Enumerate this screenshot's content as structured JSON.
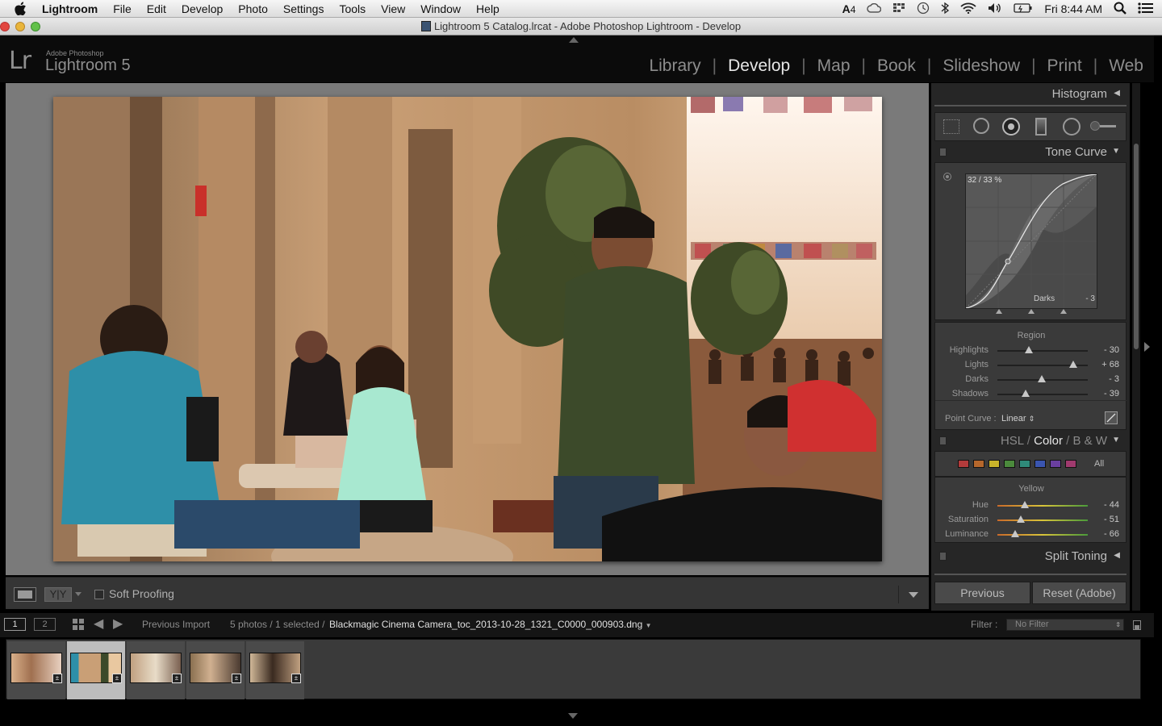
{
  "menubar": {
    "app_name": "Lightroom",
    "items": [
      "File",
      "Edit",
      "Develop",
      "Photo",
      "Settings",
      "Tools",
      "View",
      "Window",
      "Help"
    ],
    "status_badge": "4",
    "clock": "Fri 8:44 AM"
  },
  "window": {
    "title": "Lightroom 5 Catalog.lrcat - Adobe Photoshop Lightroom - Develop"
  },
  "brand": {
    "logo": "Lr",
    "small": "Adobe Photoshop",
    "big": "Lightroom 5"
  },
  "modules": {
    "library": "Library",
    "develop": "Develop",
    "map": "Map",
    "book": "Book",
    "slideshow": "Slideshow",
    "print": "Print",
    "web": "Web",
    "active": "Develop"
  },
  "histogram": {
    "title": "Histogram"
  },
  "tone_curve": {
    "title": "Tone Curve",
    "readout": "32 / 33 %",
    "region_hover": "Darks",
    "region_hover_value": "- 3",
    "region_label": "Region",
    "sliders": [
      {
        "label": "Highlights",
        "value": "- 30",
        "fraction": 0.35
      },
      {
        "label": "Lights",
        "value": "+ 68",
        "fraction": 0.84
      },
      {
        "label": "Darks",
        "value": "- 3",
        "fraction": 0.49
      },
      {
        "label": "Shadows",
        "value": "- 39",
        "fraction": 0.31
      }
    ],
    "point_curve_label": "Point Curve :",
    "point_curve_value": "Linear"
  },
  "hsl": {
    "hsl_tab": "HSL",
    "color_tab": "Color",
    "bw_tab": "B & W",
    "active_tab": "Color",
    "swatches": [
      "#b23b3b",
      "#b5672c",
      "#c9b32a",
      "#4b8a3c",
      "#2f8a7a",
      "#3a55b0",
      "#6a3fa0",
      "#a03a6e"
    ],
    "all_label": "All",
    "selected_color": "Yellow",
    "sliders": [
      {
        "label": "Hue",
        "value": "- 44",
        "fraction": 0.3
      },
      {
        "label": "Saturation",
        "value": "- 51",
        "fraction": 0.26
      },
      {
        "label": "Luminance",
        "value": "- 66",
        "fraction": 0.2
      }
    ]
  },
  "split_toning": {
    "title": "Split Toning"
  },
  "buttons": {
    "previous": "Previous",
    "reset": "Reset (Adobe)"
  },
  "toolbar": {
    "soft_proofing": "Soft Proofing"
  },
  "filmstrip_bar": {
    "screen1": "1",
    "screen2": "2",
    "source": "Previous Import",
    "count": "5 photos / 1 selected /",
    "filename": "Blackmagic Cinema Camera_toc_2013-10-28_1321_C0000_000903.dng",
    "filter_label": "Filter :",
    "filter_value": "No Filter"
  },
  "colors": {
    "accent_text": "#e6e6e6",
    "panel_bg": "#262626",
    "stage_bg": "#7a7a7a"
  }
}
